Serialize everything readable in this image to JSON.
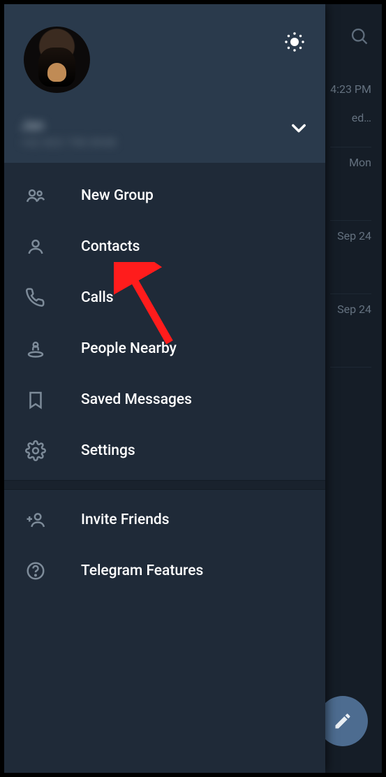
{
  "background": {
    "chats": [
      {
        "time": "4:23 PM",
        "preview": "ed…"
      },
      {
        "time": "Mon",
        "preview": ""
      },
      {
        "time": "Sep 24",
        "preview": ""
      },
      {
        "time": "Sep 24",
        "preview": ""
      }
    ]
  },
  "profile": {
    "name": "Jan",
    "phone": "+62 823 798 8948"
  },
  "menu": {
    "section1": [
      {
        "icon": "group-icon",
        "label": "New Group"
      },
      {
        "icon": "contact-icon",
        "label": "Contacts"
      },
      {
        "icon": "phone-icon",
        "label": "Calls"
      },
      {
        "icon": "nearby-icon",
        "label": "People Nearby"
      },
      {
        "icon": "bookmark-icon",
        "label": "Saved Messages"
      },
      {
        "icon": "gear-icon",
        "label": "Settings"
      }
    ],
    "section2": [
      {
        "icon": "invite-icon",
        "label": "Invite Friends"
      },
      {
        "icon": "help-icon",
        "label": "Telegram Features"
      }
    ]
  },
  "annotation": {
    "arrow_target": "Contacts"
  },
  "colors": {
    "drawer_bg": "#1f2a38",
    "drawer_header": "#2a3a4c",
    "icon": "#7d8b99",
    "text": "#ffffff",
    "app_bg": "#151d27",
    "accent_fab": "#4d6c90",
    "annotation_red": "#ff1c1c"
  }
}
